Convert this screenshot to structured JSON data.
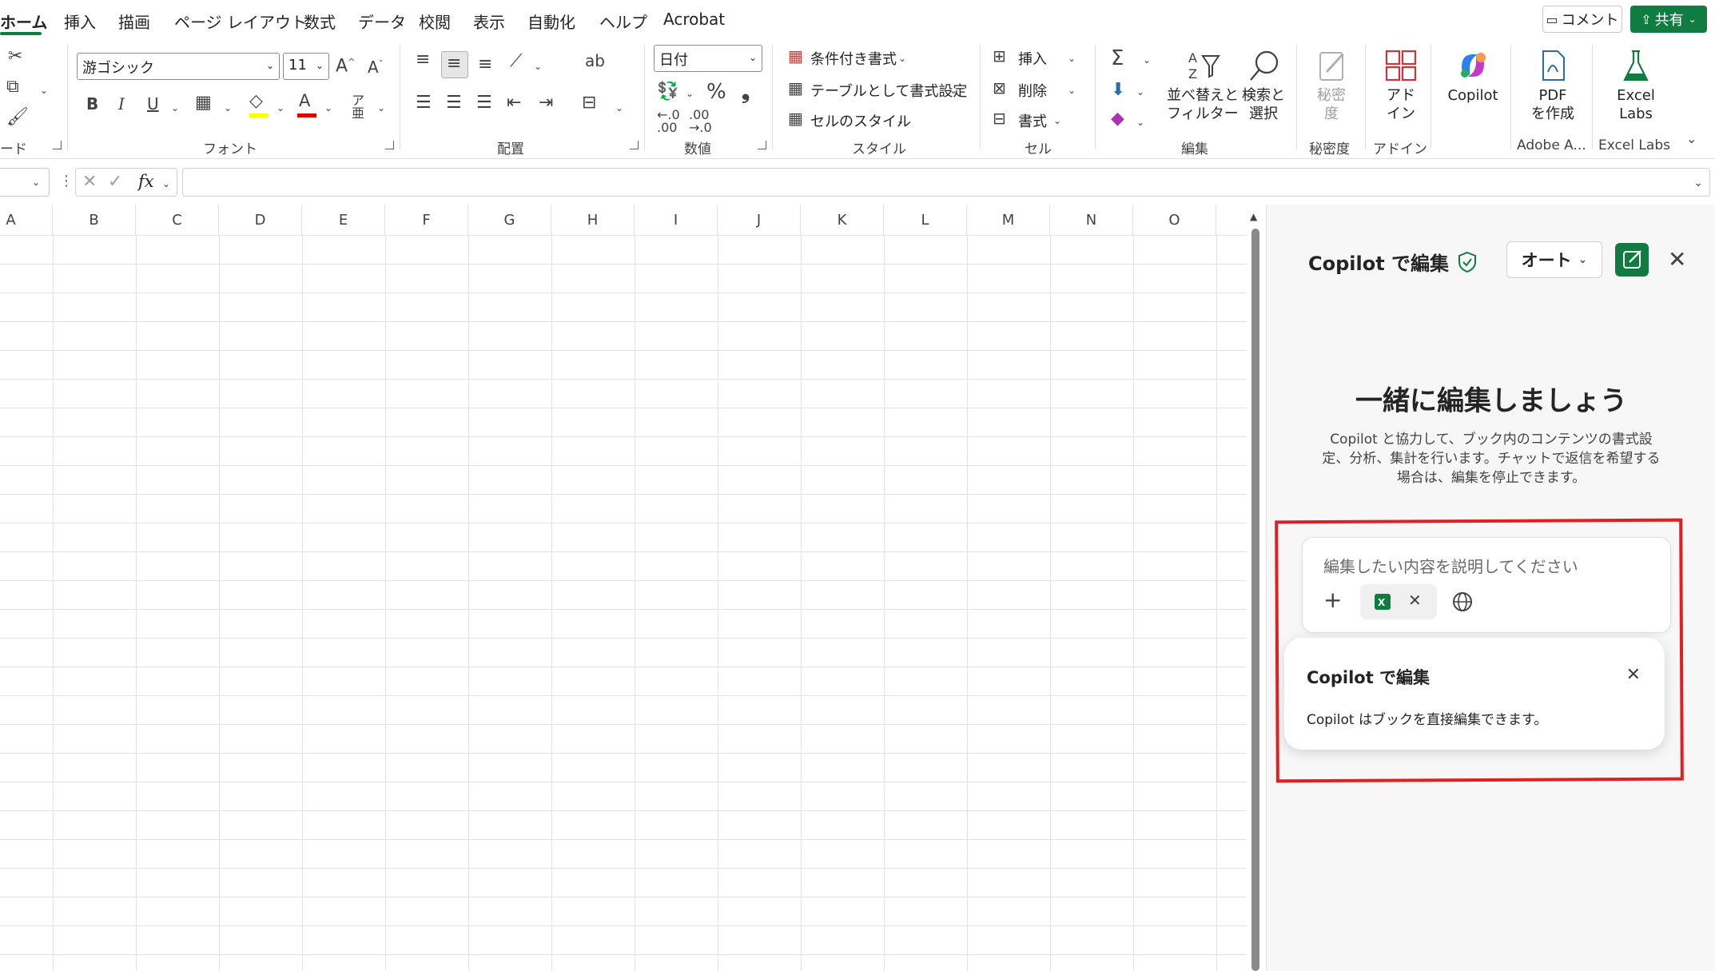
{
  "tabs": [
    "ホーム",
    "挿入",
    "描画",
    "ページ レイアウト",
    "数式",
    "データ",
    "校閲",
    "表示",
    "自動化",
    "ヘルプ",
    "Acrobat"
  ],
  "header": {
    "comment_label": "コメント",
    "share_label": "共有"
  },
  "ribbon": {
    "clipboard_label": "ード",
    "font_name": "游ゴシック",
    "font_size": "11",
    "font_group": "フォント",
    "align_group": "配置",
    "number_format": "日付",
    "number_group": "数値",
    "style_items": [
      "条件付き書式",
      "テーブルとして書式設定",
      "セルのスタイル"
    ],
    "style_group": "スタイル",
    "cell_items": [
      "挿入",
      "削除",
      "書式"
    ],
    "cell_group": "セル",
    "sort_filter": [
      "並べ替えと",
      "フィルター"
    ],
    "find_select": [
      "検索と",
      "選択"
    ],
    "edit_group": "編集",
    "sensitivity": [
      "秘密",
      "度"
    ],
    "sensitivity_group": "秘密度",
    "addin": [
      "アド",
      "イン"
    ],
    "addin_group": "アドイン",
    "copilot": "Copilot",
    "pdf": [
      "PDF",
      "を作成"
    ],
    "adobe_group": "Adobe A...",
    "excel_labs": [
      "Excel",
      "Labs"
    ],
    "excel_labs_group": "Excel Labs"
  },
  "formula_bar": {
    "fx": "fx",
    "value": ""
  },
  "columns": [
    "A",
    "B",
    "C",
    "D",
    "E",
    "F",
    "G",
    "H",
    "I",
    "J",
    "K",
    "L",
    "M",
    "N",
    "O"
  ],
  "copilot_pane": {
    "title": "Copilot で編集",
    "mode": "オート",
    "heading": "一緒に編集しましょう",
    "description": "Copilot と協力して、ブック内のコンテンツの書式設定、分析、集計を行います。チャットで返信を希望する場合は、編集を停止できます。",
    "input_placeholder": "編集したい内容を説明してください",
    "tooltip_title": "Copilot で編集",
    "tooltip_text": "Copilot はブックを直接編集できます。"
  },
  "colors": {
    "accent": "#107c41",
    "highlight": "#e02020"
  }
}
